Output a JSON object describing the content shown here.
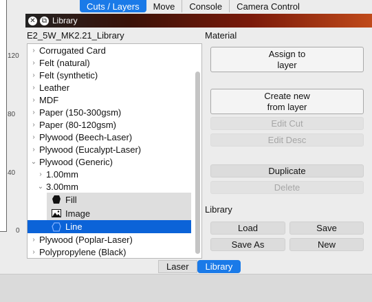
{
  "ruler": {
    "ticks": [
      "120",
      "80",
      "40",
      "0"
    ]
  },
  "top_tabs": [
    {
      "label": "Cuts / Layers",
      "active": true
    },
    {
      "label": "Move",
      "active": false
    },
    {
      "label": "Console",
      "active": false
    },
    {
      "label": "Camera Control",
      "active": false
    }
  ],
  "panel": {
    "window_title": "Library",
    "library_name": "E2_5W_MK2.21_Library",
    "tree": [
      {
        "label": "Corrugated Card",
        "expander": "chevron-right"
      },
      {
        "label": "Felt (natural)",
        "expander": "chevron-right"
      },
      {
        "label": "Felt (synthetic)",
        "expander": "chevron-right"
      },
      {
        "label": "Leather",
        "expander": "chevron-right"
      },
      {
        "label": "MDF",
        "expander": "chevron-right"
      },
      {
        "label": "Paper (150-300gsm)",
        "expander": "chevron-right"
      },
      {
        "label": "Paper (80-120gsm)",
        "expander": "chevron-right"
      },
      {
        "label": "Plywood (Beech-Laser)",
        "expander": "chevron-right"
      },
      {
        "label": "Plywood (Eucalypt-Laser)",
        "expander": "chevron-right"
      },
      {
        "label": "Plywood (Generic)",
        "expander": "chevron-down"
      },
      {
        "label": "1.00mm",
        "expander": "chevron-right"
      },
      {
        "label": "3.00mm",
        "expander": "chevron-down"
      },
      {
        "label": "Fill",
        "icon": "fill-icon"
      },
      {
        "label": "Image",
        "icon": "image-icon"
      },
      {
        "label": "Line",
        "icon": "line-icon",
        "selected": true
      },
      {
        "label": "Plywood (Poplar-Laser)",
        "expander": "chevron-right"
      },
      {
        "label": "Polypropylene (Black)",
        "expander": "chevron-right"
      }
    ],
    "material_header": "Material",
    "assign_to_layer": "Assign to\nlayer",
    "create_new_from_layer": "Create new\nfrom layer",
    "edit_cut": "Edit Cut",
    "edit_desc": "Edit Desc",
    "duplicate": "Duplicate",
    "delete": "Delete",
    "library_header": "Library",
    "load": "Load",
    "save": "Save",
    "save_as": "Save As",
    "new": "New"
  },
  "bottom_tabs": [
    {
      "label": "Laser",
      "active": false
    },
    {
      "label": "Library",
      "active": true
    }
  ]
}
